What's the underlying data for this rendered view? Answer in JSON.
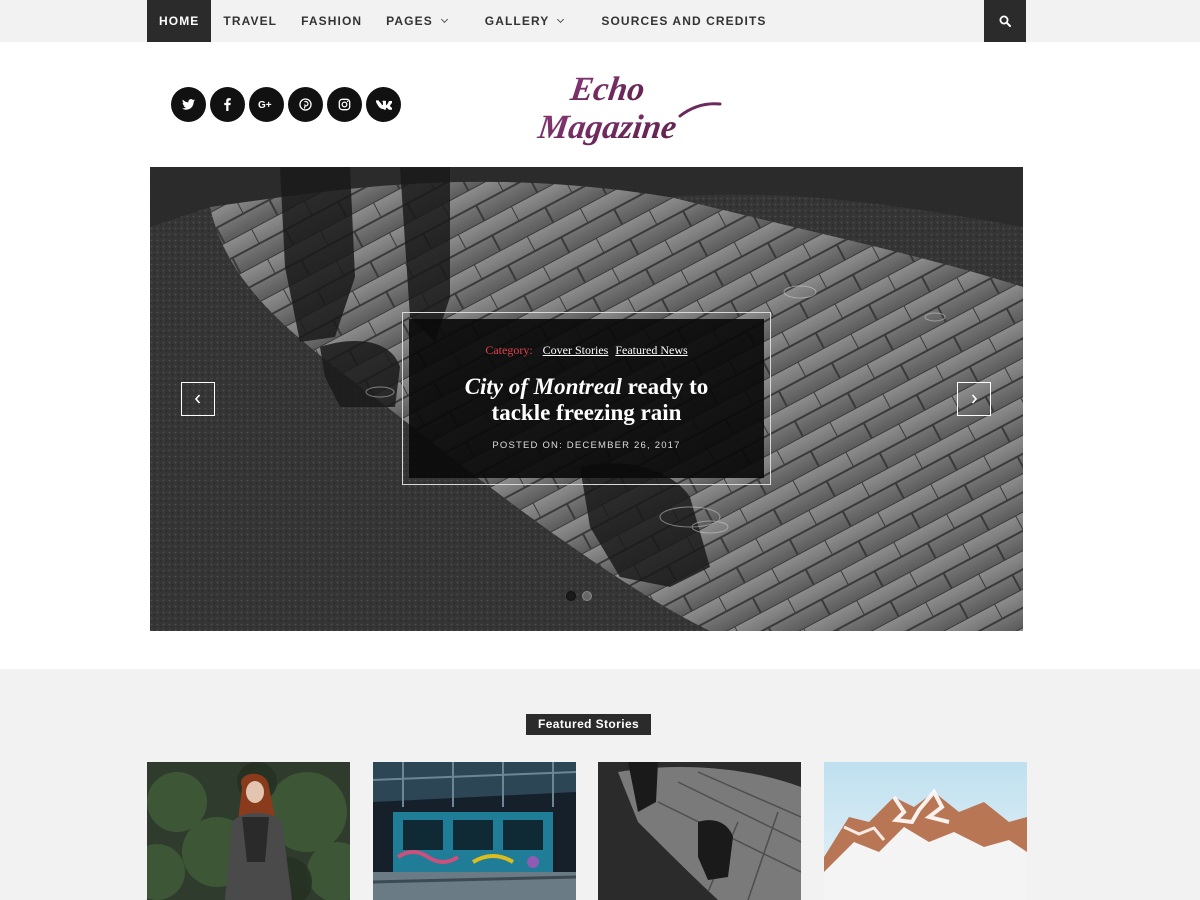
{
  "nav": {
    "items": [
      {
        "label": "Home",
        "has_dropdown": false,
        "active": true
      },
      {
        "label": "Travel",
        "has_dropdown": false,
        "active": false
      },
      {
        "label": "Fashion",
        "has_dropdown": false,
        "active": false
      },
      {
        "label": "Pages",
        "has_dropdown": true,
        "active": false
      },
      {
        "label": "Gallery",
        "has_dropdown": true,
        "active": false
      },
      {
        "label": "Sources and Credits",
        "has_dropdown": false,
        "active": false
      }
    ],
    "search_icon": "search-icon"
  },
  "header": {
    "social_icons": [
      "twitter-icon",
      "facebook-icon",
      "google-plus-icon",
      "pinterest-icon",
      "instagram-icon",
      "vk-icon"
    ],
    "logo_line1": "Echo",
    "logo_line2": "Magazine",
    "logo_color": "#6b2a5c"
  },
  "hero": {
    "category_label": "Category:",
    "categories": [
      "Cover Stories",
      "Featured News"
    ],
    "title_italic": "City of Montreal",
    "title_rest": "ready to tackle freezing rain",
    "posted_label": "Posted On:",
    "date": "December 26, 2017",
    "slides_total": 2,
    "active_slide": 1
  },
  "featured": {
    "heading": "Featured Stories",
    "thumbnails": [
      "woman-in-forest-photo",
      "graffiti-building-photo",
      "puddle-reflection-photo",
      "snowy-mountain-photo"
    ]
  },
  "colors": {
    "accent_red": "#e0434d",
    "dark": "#2b2b2b",
    "light_bg": "#f2f2f2"
  }
}
